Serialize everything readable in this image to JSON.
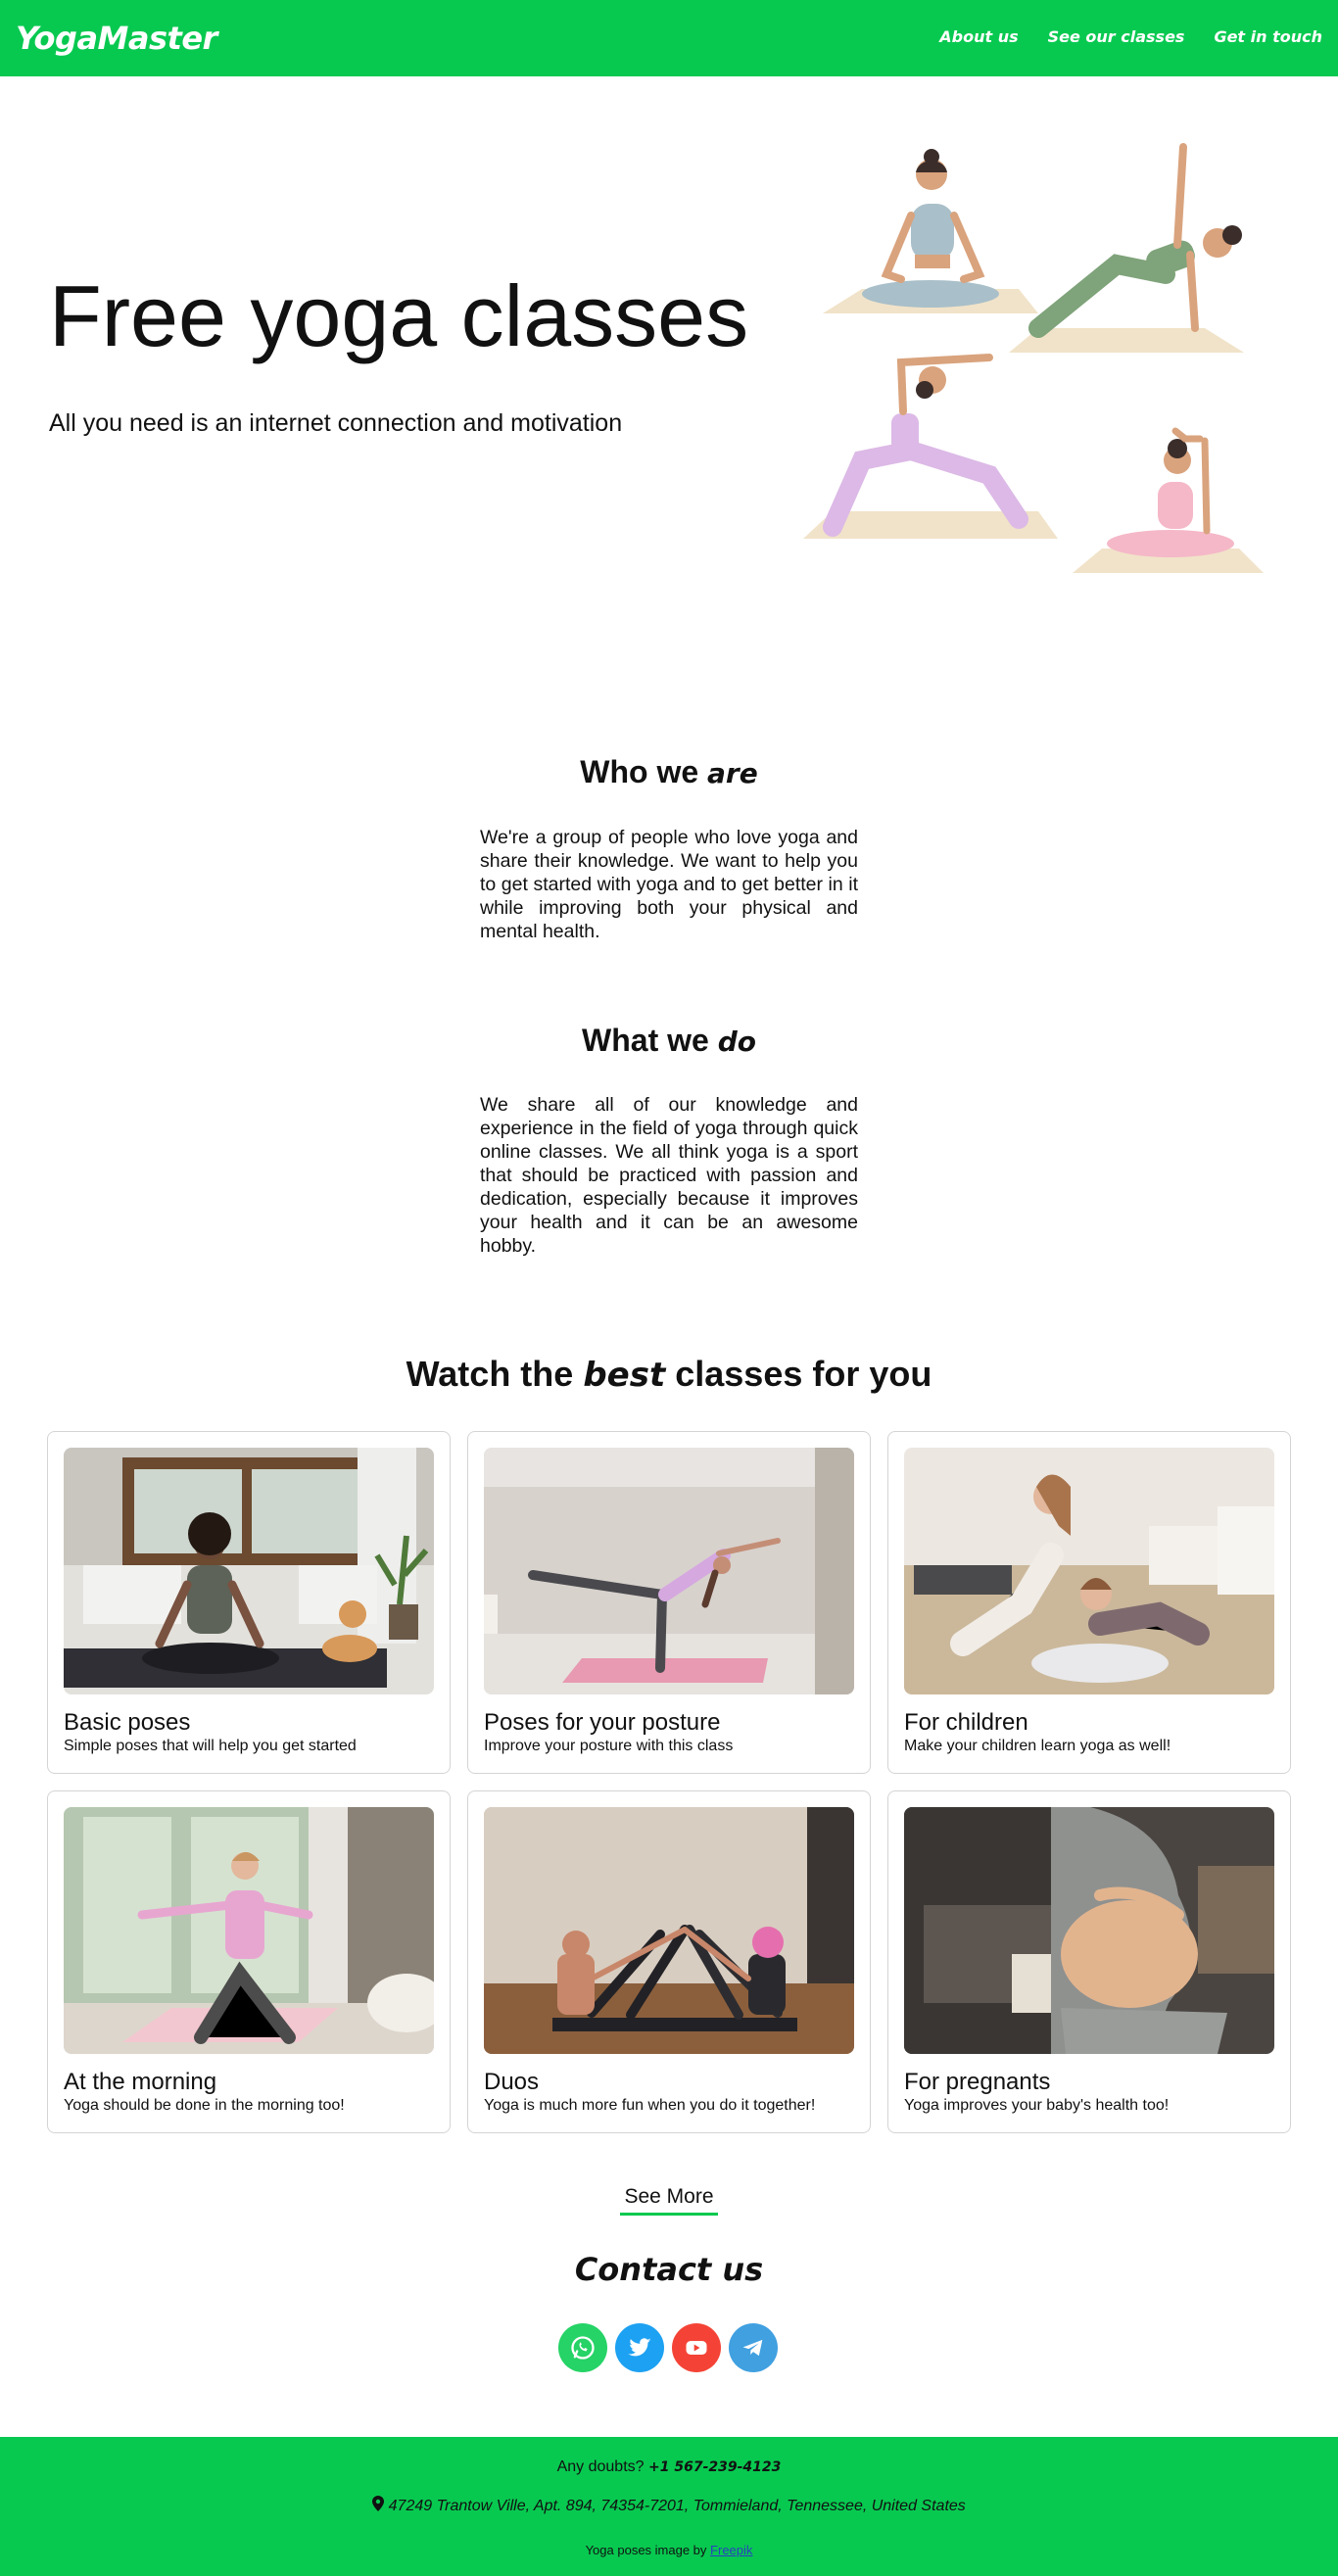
{
  "header": {
    "brand": "YogaMaster",
    "nav": [
      "About us",
      "See our classes",
      "Get in touch"
    ]
  },
  "hero": {
    "title": "Free yoga classes",
    "subtitle": "All you need is an internet connection and motivation"
  },
  "who": {
    "title_prefix": "Who we",
    "title_accent": "are",
    "text": "We're a group of people who love yoga and share their knowledge. We want to help you to get started with yoga and to get better in it while improving both your physical and mental health."
  },
  "what": {
    "title_prefix": "What we",
    "title_accent": "do",
    "text": "We share all of our knowledge and experience in the field of yoga through quick online classes. We all think yoga is a sport that should be practiced with passion and dedication, especially because it improves your health and it can be an awesome hobby."
  },
  "classes": {
    "title_prefix": "Watch the",
    "title_accent": "best",
    "title_suffix": "classes for you",
    "cards": [
      {
        "title": "Basic poses",
        "desc": "Simple poses that will help you get started"
      },
      {
        "title": "Poses for your posture",
        "desc": "Improve your posture with this class"
      },
      {
        "title": "For children",
        "desc": "Make your children learn yoga as well!"
      },
      {
        "title": "At the morning",
        "desc": "Yoga should be done in the morning too!"
      },
      {
        "title": "Duos",
        "desc": "Yoga is much more fun when you do it together!"
      },
      {
        "title": "For pregnants",
        "desc": "Yoga improves your baby's health too!"
      }
    ],
    "see_more": "See More"
  },
  "contact": {
    "title": "Contact us",
    "socials": [
      {
        "icon": "whatsapp-icon",
        "color": "#25d366"
      },
      {
        "icon": "twitter-icon",
        "color": "#1da1f2"
      },
      {
        "icon": "youtube-icon",
        "color": "#f44336"
      },
      {
        "icon": "telegram-icon",
        "color": "#40a0e0"
      }
    ]
  },
  "footer": {
    "doubts": "Any doubts?",
    "phone": "+1 567-239-4123",
    "address": "47249 Trantow Ville, Apt. 894, 74354-7201, Tommieland, Tennessee, United States",
    "credit_text": "Yoga poses image by",
    "credit_link": "Freepik"
  },
  "colors": {
    "brand_green": "#08c950"
  }
}
